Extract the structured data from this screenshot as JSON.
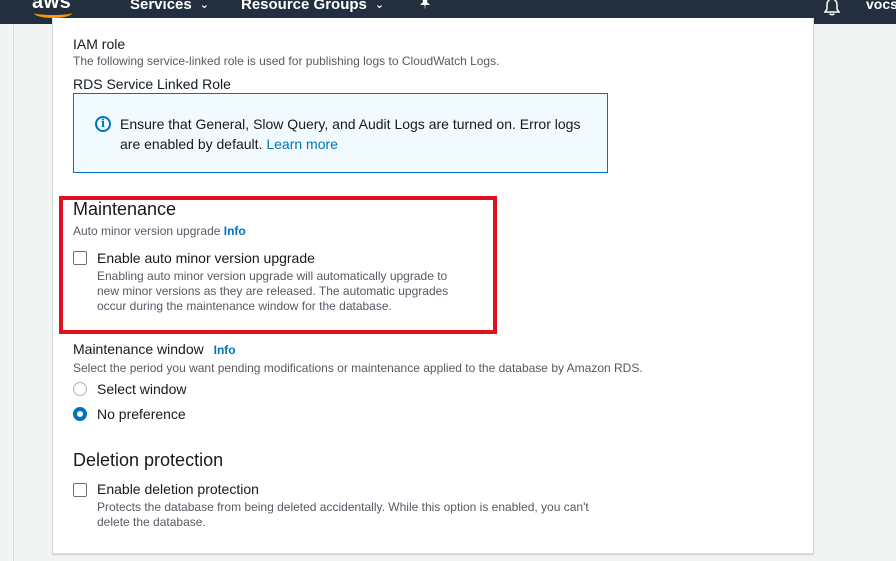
{
  "nav": {
    "logo": "aws",
    "services": "Services",
    "resource_groups": "Resource Groups",
    "caret": "⌄",
    "user": "vocs"
  },
  "iam": {
    "title": "IAM role",
    "description": "The following service-linked role is used for publishing logs to CloudWatch Logs.",
    "role_name": "RDS Service Linked Role"
  },
  "info_box": {
    "text": "Ensure that General, Slow Query, and Audit Logs are turned on. Error logs are enabled by default. ",
    "link": "Learn more"
  },
  "maintenance": {
    "heading": "Maintenance",
    "auto_upgrade_label": "Auto minor version upgrade",
    "info": "Info",
    "checkbox_label": "Enable auto minor version upgrade",
    "checkbox_description": "Enabling auto minor version upgrade will automatically upgrade to new minor versions as they are released. The automatic upgrades occur during the maintenance window for the database.",
    "checked": false
  },
  "maintenance_window": {
    "title": "Maintenance window",
    "info": "Info",
    "description": "Select the period you want pending modifications or maintenance applied to the database by Amazon RDS.",
    "options": [
      {
        "label": "Select window",
        "selected": false
      },
      {
        "label": "No preference",
        "selected": true
      }
    ]
  },
  "deletion_protection": {
    "heading": "Deletion protection",
    "checkbox_label": "Enable deletion protection",
    "checkbox_description": "Protects the database from being deleted accidentally. While this option is enabled, you can't delete the database.",
    "checked": false
  },
  "colors": {
    "nav_bg": "#232f3e",
    "accent": "#0073bb",
    "highlight": "#e0121f",
    "aws_orange": "#ff9900"
  },
  "icons": [
    "info-circle-icon",
    "bell-icon",
    "pin-icon",
    "chevron-down-icon"
  ]
}
